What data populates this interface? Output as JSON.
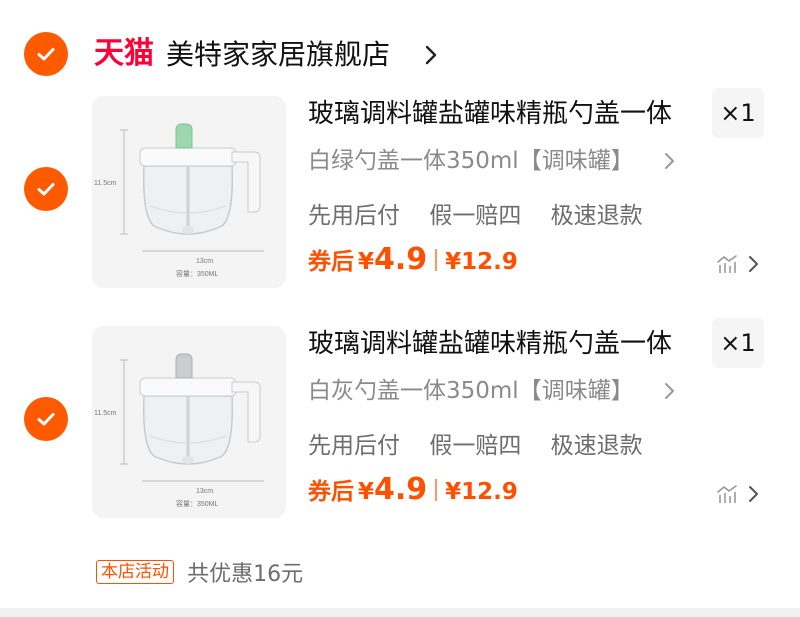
{
  "store": {
    "platform_logo": "天猫",
    "name": "美特家家居旗舰店",
    "selected": true
  },
  "items": [
    {
      "title": "玻璃调料罐盐罐味精瓶勺盖一体",
      "quantity": "×1",
      "spec": "白绿勺盖一体350ml【调味罐】",
      "services": [
        "先用后付",
        "假一赔四",
        "极速退款"
      ],
      "price_label": "券后",
      "price_symbol": "¥",
      "price_value": "4.9",
      "original_price": "¥12.9",
      "thumb_height_label": "11.5cm",
      "thumb_width_label": "13cm",
      "thumb_capacity_label": "容量：350ML",
      "lid_color": "#9ed6b0",
      "selected": true
    },
    {
      "title": "玻璃调料罐盐罐味精瓶勺盖一体",
      "quantity": "×1",
      "spec": "白灰勺盖一体350ml【调味罐】",
      "services": [
        "先用后付",
        "假一赔四",
        "极速退款"
      ],
      "price_label": "券后",
      "price_symbol": "¥",
      "price_value": "4.9",
      "original_price": "¥12.9",
      "thumb_height_label": "11.5cm",
      "thumb_width_label": "13cm",
      "thumb_capacity_label": "容量：350ML",
      "lid_color": "#c9cfcf",
      "selected": true
    }
  ],
  "promo": {
    "badge": "本店活动",
    "text": "共优惠16元"
  },
  "colors": {
    "accent": "#ff5000",
    "tmall_red": "#ff0036",
    "check_orange": "#ff5a00"
  },
  "icons": {
    "check": "check-icon",
    "chevron": "chevron-right-icon",
    "price_trend": "price-trend-icon"
  }
}
